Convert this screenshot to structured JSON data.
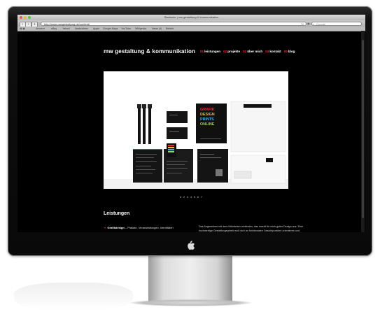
{
  "browser": {
    "window_title": "Startseite | mw gestaltung & kommunikation",
    "url": "http://www.mwgestaltung.de/content/",
    "search_placeholder": "Google",
    "bookmarks": [
      "Amazon",
      "eBay",
      "Yahoo!",
      "Nachrichten",
      "Apple",
      "Google Maps",
      "YouTube",
      "Wikipedia",
      "News (4)",
      "Beliebt"
    ]
  },
  "site": {
    "title": "mw gestaltung & kommunikation",
    "nav": [
      {
        "num": "01",
        "label": "leistungen"
      },
      {
        "num": "02",
        "label": "projekte"
      },
      {
        "num": "03",
        "label": "über mich"
      },
      {
        "num": "04",
        "label": "kontakt"
      },
      {
        "num": "05",
        "label": "blog"
      }
    ],
    "pager": [
      "1",
      "2",
      "3",
      "4",
      "5",
      "6",
      "7"
    ],
    "section_title": "Leistungen",
    "services": [
      {
        "name": "Grafikdesign",
        "desc": " – Plakate, Veranstaltungen, Identitäten"
      }
    ],
    "intro": "Das Angenehme mit dem Nützlichen verbinden, das macht für mich gutes Design aus. Eine hochwertige Gestaltungsarbeit muß sich an funktionalen Gesichtpunkten orientieren und darüber hinaus einen",
    "poster_text": [
      "GRAFIK",
      "DESIGN",
      "PRINTS",
      "ONLINE"
    ]
  },
  "colors": {
    "accent": "#e8273a",
    "background": "#000000",
    "text": "#ffffff"
  }
}
